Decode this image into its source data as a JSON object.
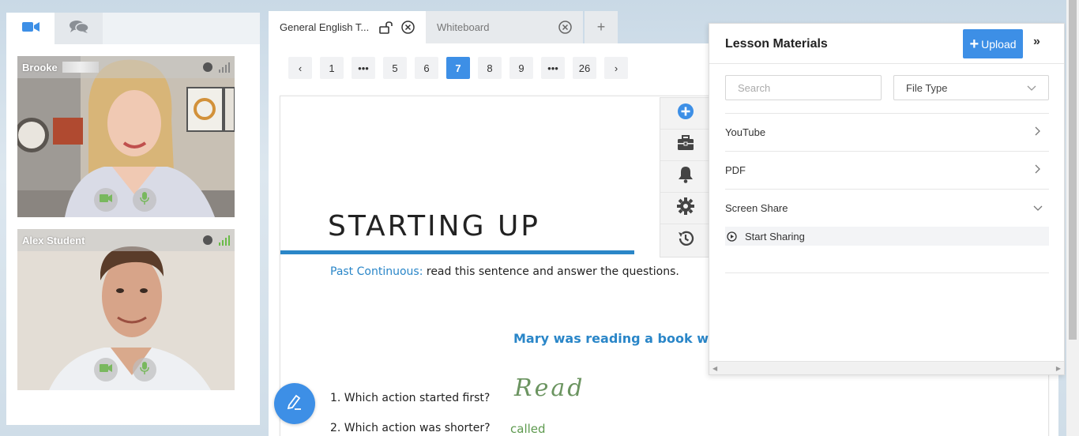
{
  "left_panel": {
    "tabs": [
      {
        "icon": "video-camera-icon"
      },
      {
        "icon": "chat-bubbles-icon"
      }
    ],
    "participants": [
      {
        "name": "Brooke",
        "signal": "weak",
        "controls": [
          "camera-icon",
          "microphone-icon"
        ]
      },
      {
        "name": "Alex Student",
        "signal": "good",
        "controls": [
          "camera-icon",
          "microphone-icon"
        ]
      }
    ]
  },
  "doc_tabs": [
    {
      "label": "General English T...",
      "active": true,
      "icons": [
        "unlock-icon",
        "close-circle-icon"
      ]
    },
    {
      "label": "Whiteboard",
      "active": false,
      "icons": [
        "close-circle-icon"
      ]
    }
  ],
  "add_tab_label": "+",
  "pager": {
    "prev": "‹",
    "next": "›",
    "pages": [
      "1",
      "•••",
      "5",
      "6",
      "7",
      "8",
      "9",
      "•••",
      "26"
    ],
    "current": "7"
  },
  "slide": {
    "title": "STARTING UP",
    "instruction_highlight": "Past Continuous:",
    "instruction_rest": " read this sentence and answer the questions.",
    "sentence": "Mary was reading a book whe",
    "q1": "1. Which action started first?",
    "q2": "2. Which action was shorter?",
    "handwriting_1": "Read",
    "handwriting_2": "called"
  },
  "tools": [
    "add-circle-icon",
    "toolbox-icon",
    "bell-icon",
    "gear-icon",
    "history-icon"
  ],
  "lesson_materials": {
    "title": "Lesson Materials",
    "upload_label": "Upload",
    "collapse_label": "»",
    "search_placeholder": "Search",
    "file_type_label": "File Type",
    "rows": [
      {
        "label": "YouTube",
        "state": "collapsed"
      },
      {
        "label": "PDF",
        "state": "collapsed"
      },
      {
        "label": "Screen Share",
        "state": "expanded"
      }
    ],
    "screen_share_action": "Start Sharing"
  },
  "colors": {
    "accent": "#3d8fe6",
    "slide_blue": "#2a86c8",
    "handwriting_green": "#6b9460",
    "signal_good": "#6abb48"
  }
}
